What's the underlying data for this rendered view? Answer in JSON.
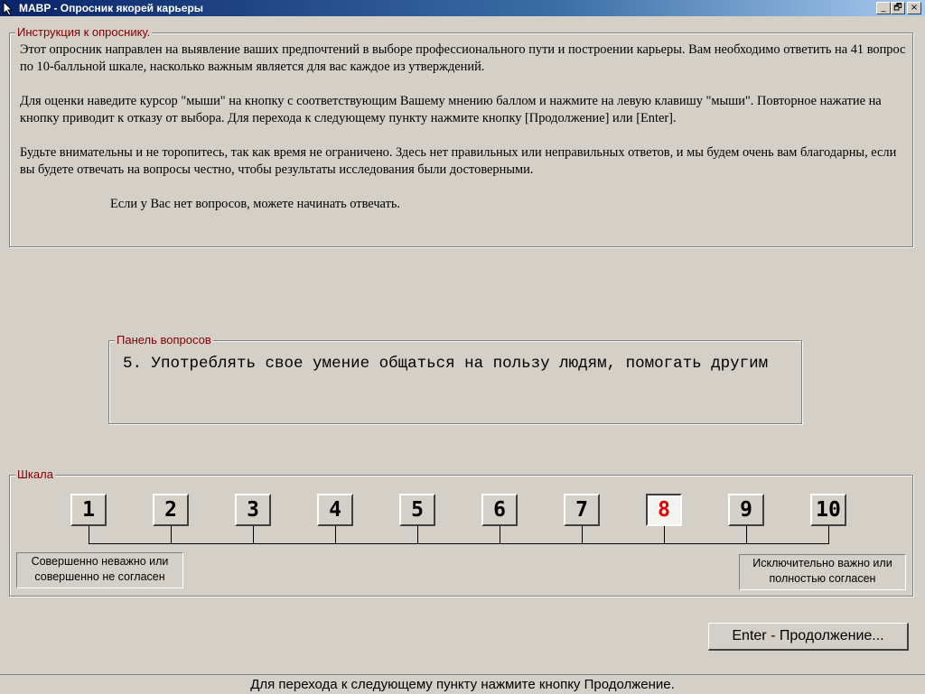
{
  "window": {
    "title": "MABP - Опросник якорей карьеры",
    "controls": [
      "_",
      "🗗",
      "×"
    ]
  },
  "instructions": {
    "legend": "Инструкция к опроснику.",
    "paragraphs": [
      "Этот опросник направлен на выявление ваших предпочтений в выборе профессионального пути и построении карьеры. Вам необходимо ответить на 41 вопрос по 10-балльной шкале, насколько важным является для вас каждое из утверждений.",
      "Для оценки наведите курсор \"мыши\" на кнопку с соответствующим Вашему мнению баллом и нажмите на левую клавишу \"мыши\". Повторное нажатие на кнопку приводит к отказу от выбора. Для перехода к следующему пункту нажмите кнопку [Продолжение] или [Enter].",
      "Будьте внимательны и не торопитесь, так как время не ограничено. Здесь нет правильных или неправильных ответов, и мы будем очень вам благодарны, если вы будете отвечать на вопросы честно, чтобы результаты исследования были достоверными."
    ],
    "closing": "Если у Вас нет вопросов, можете начинать отвечать."
  },
  "question_panel": {
    "legend": "Панель вопросов",
    "number": "5.",
    "text": "Употреблять свое умение общаться на пользу людям, помогать другим"
  },
  "scale": {
    "legend": "Шкала",
    "buttons": [
      "1",
      "2",
      "3",
      "4",
      "5",
      "6",
      "7",
      "8",
      "9",
      "10"
    ],
    "selected": "8",
    "selected_color": "#e00000",
    "low_label": "Совершенно неважно или совершенно не согласен",
    "high_label": "Исключительно важно или полностью согласен"
  },
  "continue_button": "Enter - Продолжение...",
  "status_bar": "Для перехода к следующему пункту нажмите кнопку Продолжение."
}
